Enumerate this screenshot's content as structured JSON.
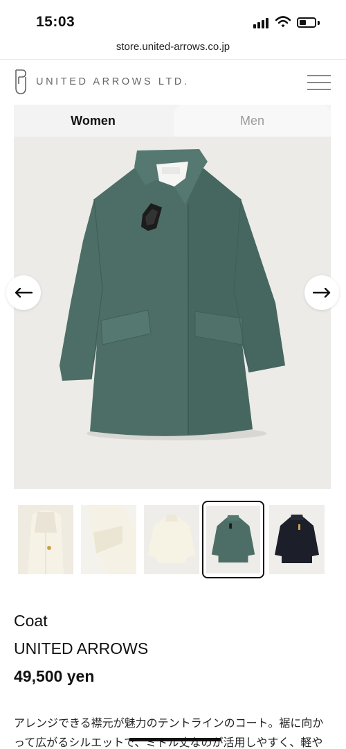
{
  "status_bar": {
    "time": "15:03",
    "icons": [
      "cellular-signal-icon",
      "wifi-icon",
      "battery-icon"
    ]
  },
  "browser": {
    "url": "store.united-arrows.co.jp"
  },
  "header": {
    "logo_text": "UNITED ARROWS LTD.",
    "menu_icon": "hamburger-menu-icon"
  },
  "tabs": [
    {
      "label": "Women",
      "active": true
    },
    {
      "label": "Men",
      "active": false
    }
  ],
  "carousel": {
    "prev_icon": "arrow-left-icon",
    "next_icon": "arrow-right-icon",
    "current_image_color": "#4d6e66",
    "thumbnails": [
      {
        "desc": "collar-closeup",
        "color": "#f3efe2",
        "selected": false
      },
      {
        "desc": "sleeve-detail",
        "color": "#f3efe2",
        "selected": false
      },
      {
        "desc": "cream-coat-back",
        "color": "#f3efe2",
        "selected": false
      },
      {
        "desc": "green-coat",
        "color": "#4d6e66",
        "selected": true
      },
      {
        "desc": "navy-coat",
        "color": "#1c1f2a",
        "selected": false
      }
    ]
  },
  "product": {
    "category": "Coat",
    "brand": "UNITED ARROWS",
    "price": "49,500 yen",
    "description": "アレンジできる襟元が魅力のテントラインのコート。裾に向かって広がるシルエットで、ミドル丈なのが活用しやすく、軽やかな着心地です。ド"
  }
}
